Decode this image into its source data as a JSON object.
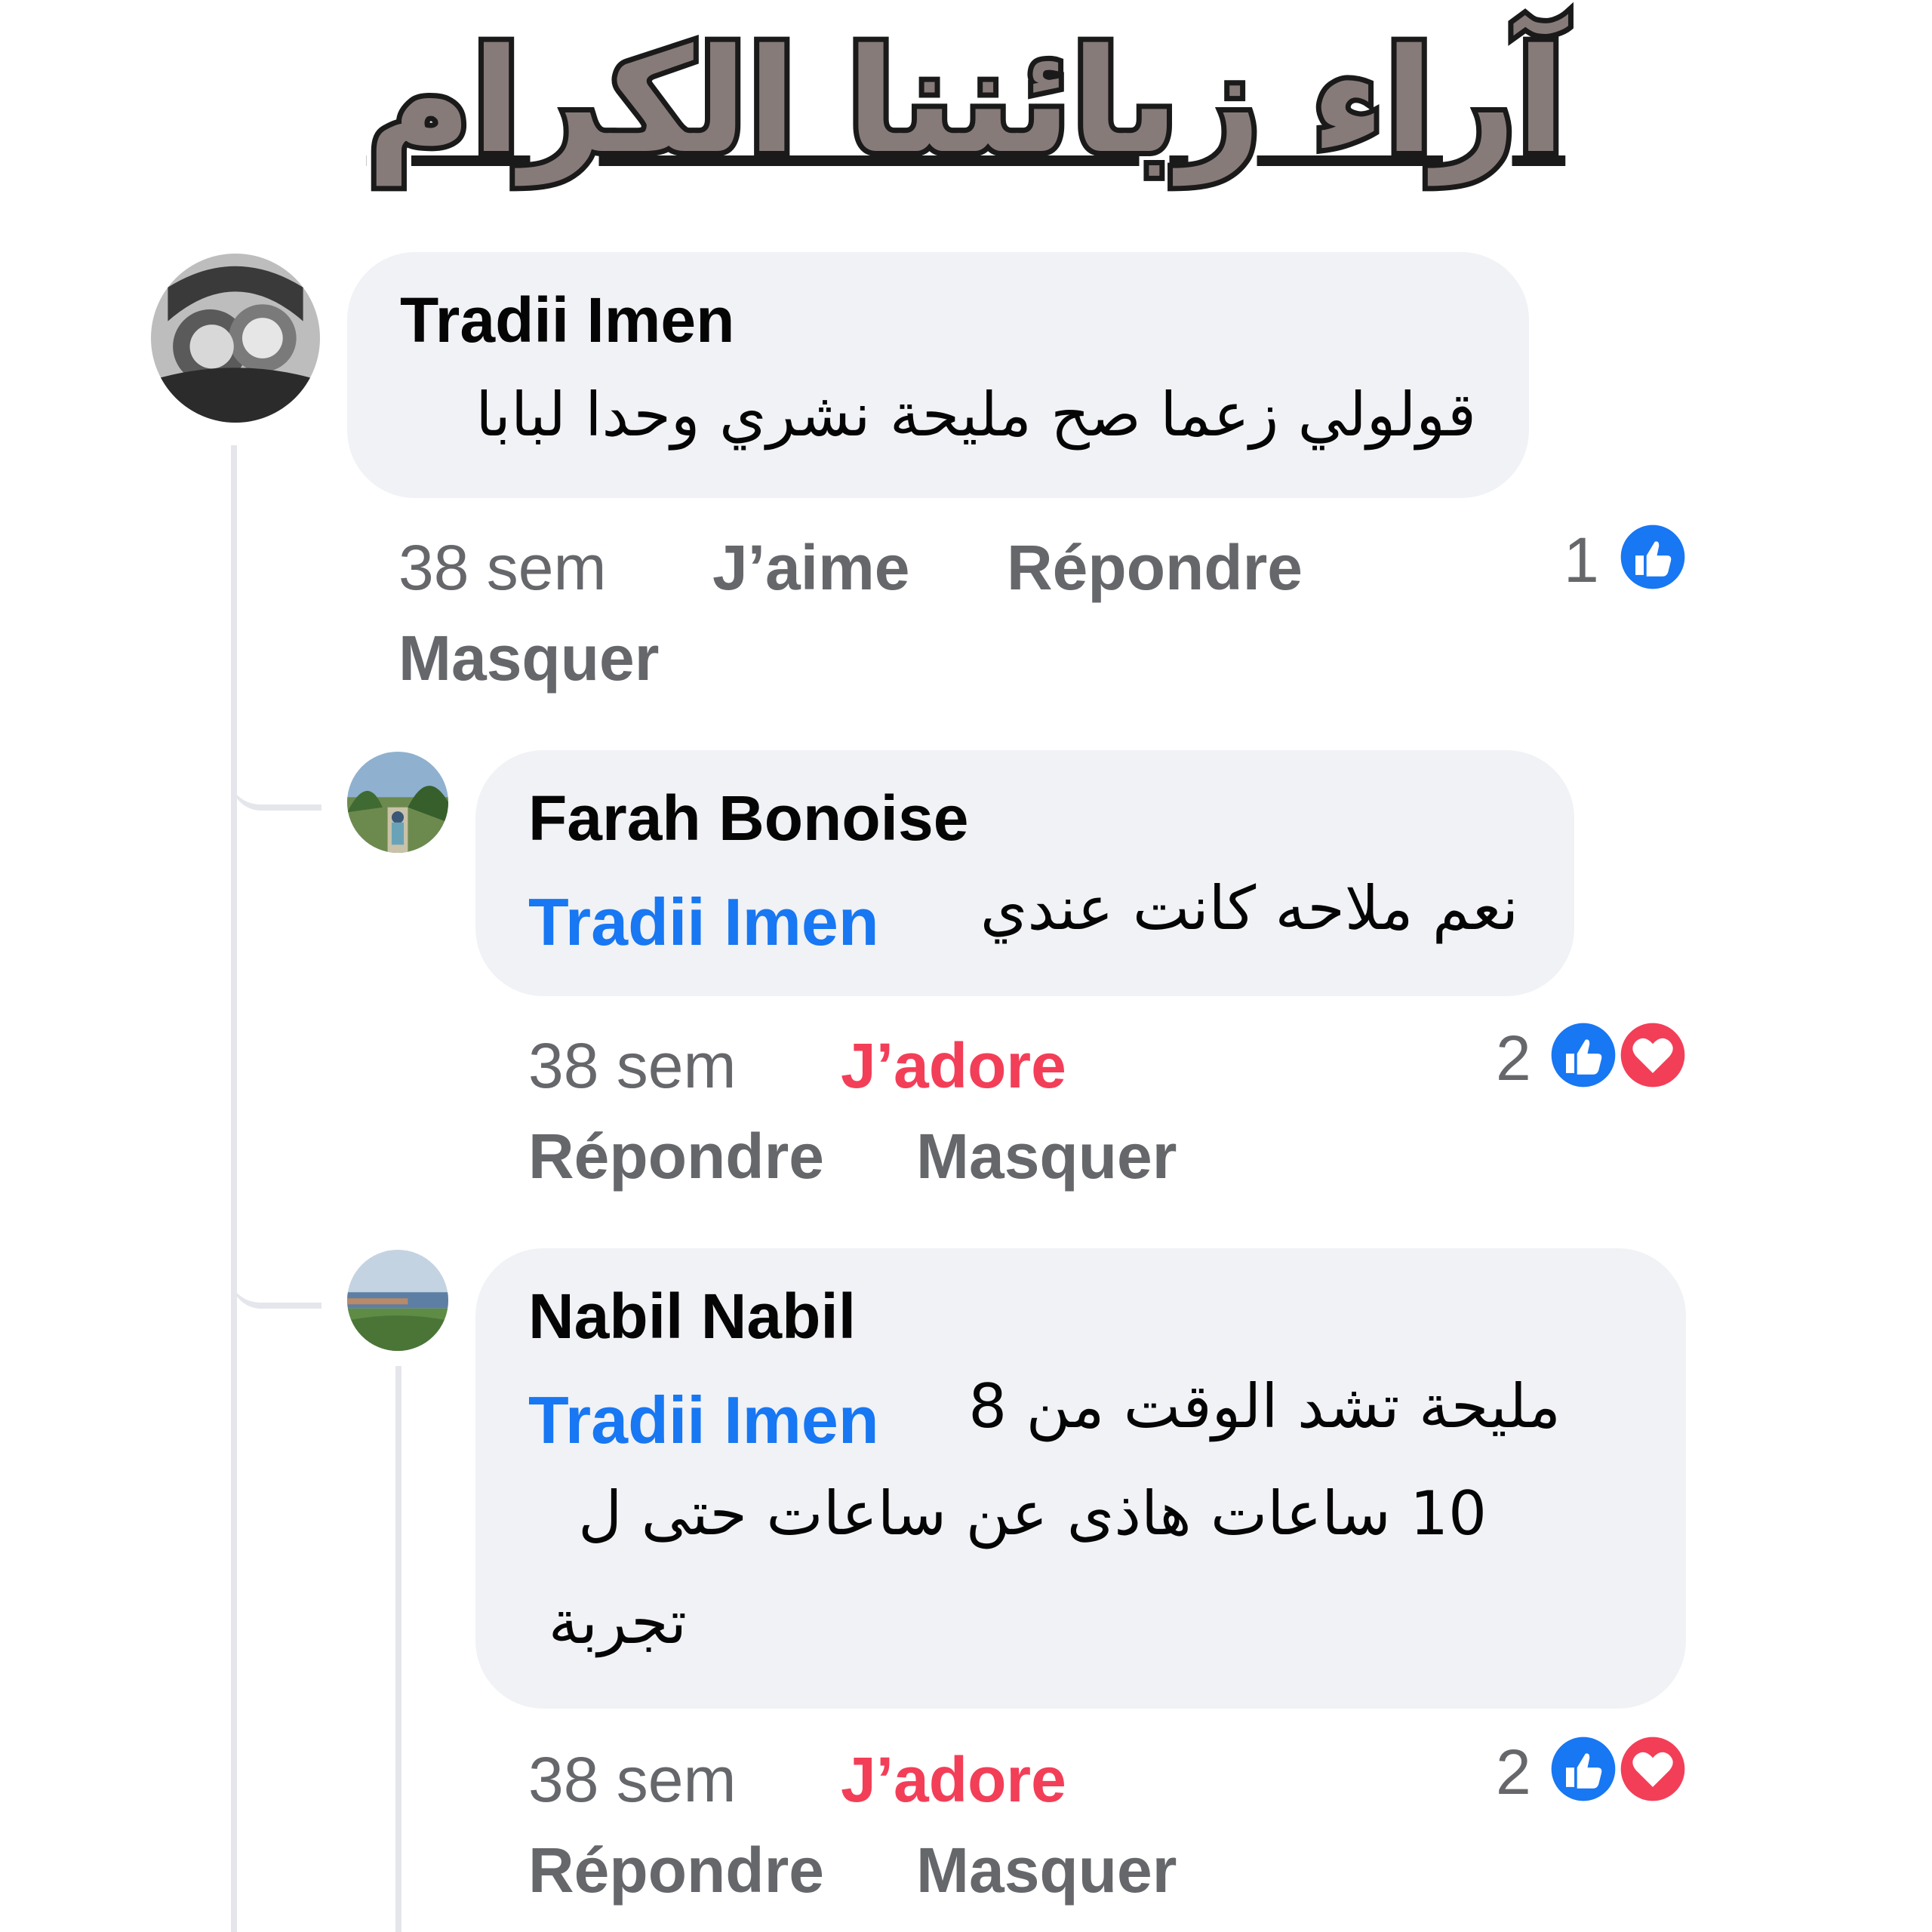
{
  "header": {
    "title": "آراء زبائننا الكرام"
  },
  "comments": [
    {
      "author": "Tradii Imen",
      "text": "قولولي زعما صح مليحة نشري وحدا لبابا",
      "time": "38 sem",
      "like_label": "J’aime",
      "reply_label": "Répondre",
      "hide_label": "Masquer",
      "reaction_count": "1",
      "reactions": [
        "like-icon"
      ]
    }
  ],
  "replies": [
    {
      "author": "Farah Bonoise",
      "mention": "Tradii Imen",
      "text_lines": [
        "نعم ملاحه كانت عندي"
      ],
      "time": "38 sem",
      "react_label": "J’adore",
      "reply_label": "Répondre",
      "hide_label": "Masquer",
      "reaction_count": "2",
      "reactions": [
        "like-icon",
        "love-icon"
      ]
    },
    {
      "author": "Nabil Nabil",
      "mention": "Tradii Imen",
      "text_lines": [
        "مليحة تشد الوقت من 8",
        "10 ساعات هاذى عن ساعات حتى ل",
        "تجربة"
      ],
      "time": "38 sem",
      "react_label": "J’adore",
      "reply_label": "Répondre",
      "hide_label": "Masquer",
      "reaction_count": "2",
      "reactions": [
        "like-icon",
        "love-icon"
      ]
    }
  ],
  "colors": {
    "bubble": "#F0F2F5",
    "mention": "#1877F2",
    "love": "#F33E58",
    "meta": "#65676B",
    "title_fill": "#877B7A"
  }
}
